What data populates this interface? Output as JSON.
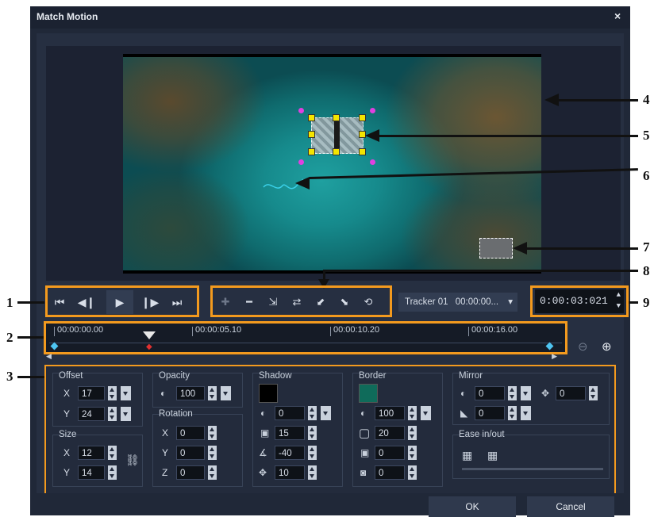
{
  "window": {
    "title": "Match Motion",
    "close_icon": "×"
  },
  "tracker": {
    "name": "Tracker 01",
    "time": "00:00:00..."
  },
  "timecode": "0:00:03:021",
  "timeline": {
    "ticks": [
      "00:00:00.00",
      "00:00:05.10",
      "00:00:10.20",
      "00:00:16.00"
    ]
  },
  "callouts": [
    "1",
    "2",
    "3",
    "4",
    "5",
    "6",
    "7",
    "8",
    "9"
  ],
  "offset": {
    "label": "Offset",
    "x_label": "X",
    "x": "17",
    "y_label": "Y",
    "y": "24"
  },
  "size": {
    "label": "Size",
    "x_label": "X",
    "x": "12",
    "y_label": "Y",
    "y": "14"
  },
  "opacity": {
    "label": "Opacity",
    "value": "100"
  },
  "rotation": {
    "label": "Rotation",
    "x_label": "X",
    "x": "0",
    "y_label": "Y",
    "y": "0",
    "z_label": "Z",
    "z": "0"
  },
  "shadow": {
    "label": "Shadow",
    "color": "#000000",
    "opacity": "0",
    "blur": "15",
    "angle": "-40",
    "distance": "10"
  },
  "border": {
    "label": "Border",
    "color": "#0f6b5a",
    "opacity": "100",
    "width": "20",
    "blur": "0",
    "corner": "0"
  },
  "mirror": {
    "label": "Mirror",
    "opacity": "0",
    "offset": "0",
    "distance": "0"
  },
  "ease": {
    "label": "Ease in/out"
  },
  "buttons": {
    "ok": "OK",
    "cancel": "Cancel"
  },
  "colors": {
    "accent": "#f39a1e",
    "dialog_bg": "#202838"
  }
}
